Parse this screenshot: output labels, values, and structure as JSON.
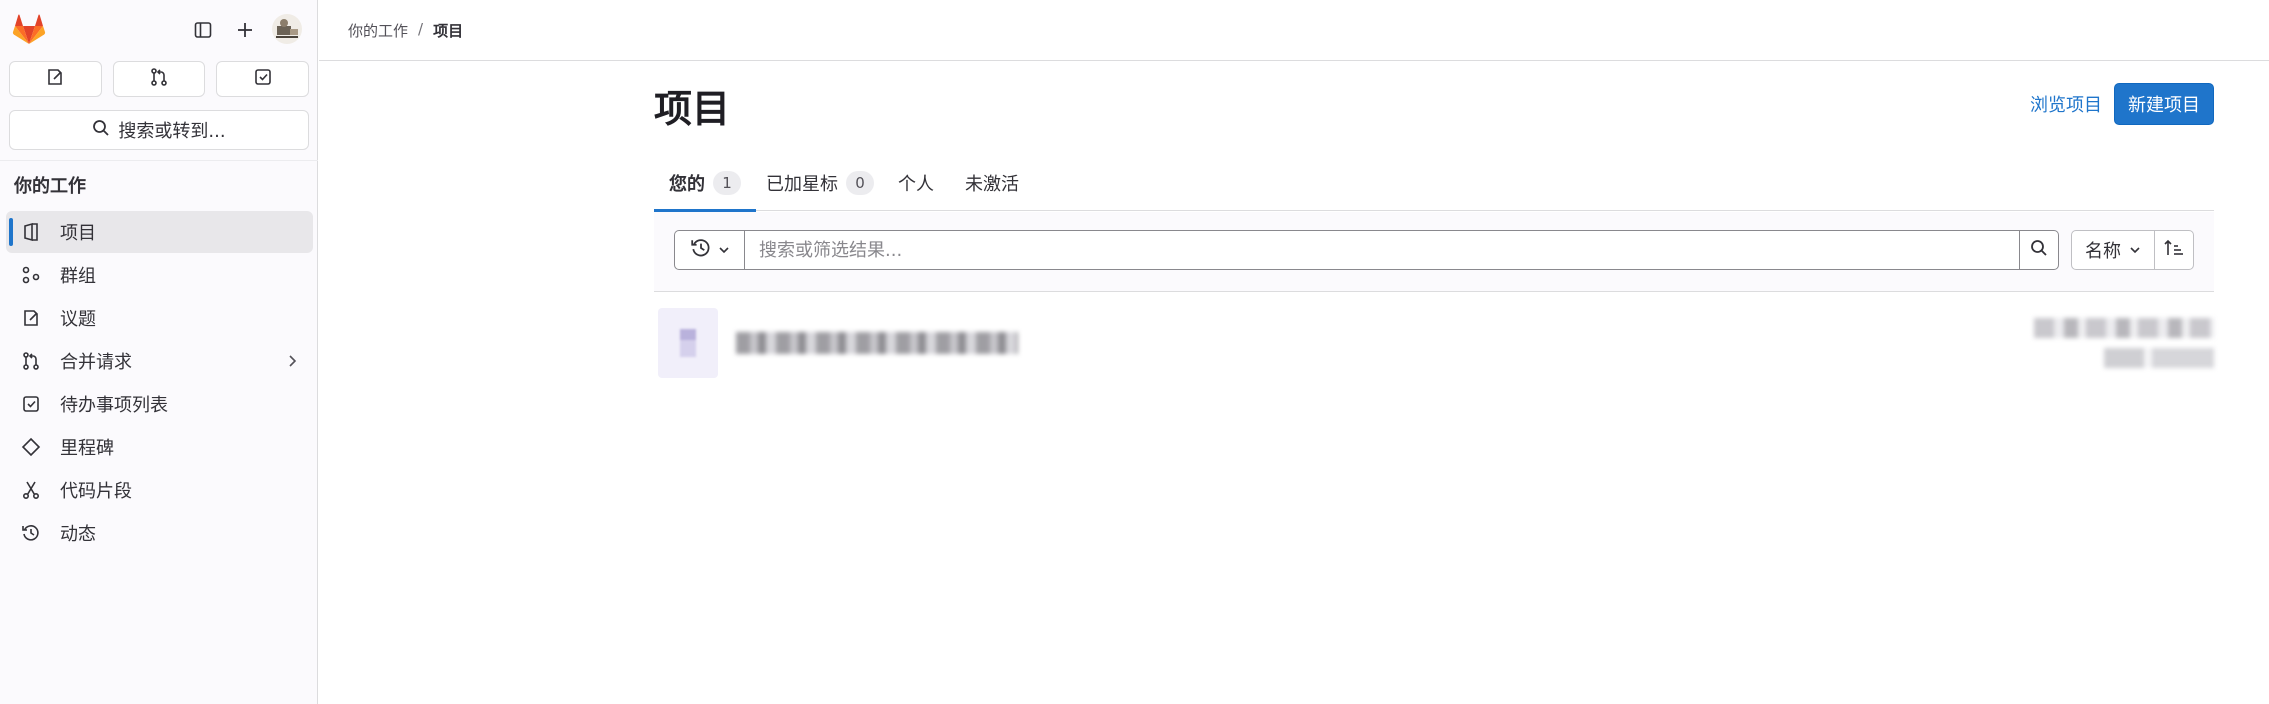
{
  "sidebar": {
    "quick_actions": [
      {
        "name": "issues"
      },
      {
        "name": "merge-requests"
      },
      {
        "name": "todos"
      }
    ],
    "search_label": "搜索或转到...",
    "section_title": "你的工作",
    "items": [
      {
        "label": "项目",
        "icon": "project-icon"
      },
      {
        "label": "群组",
        "icon": "group-icon"
      },
      {
        "label": "议题",
        "icon": "issues-icon"
      },
      {
        "label": "合并请求",
        "icon": "merge-request-icon"
      },
      {
        "label": "待办事项列表",
        "icon": "todo-icon"
      },
      {
        "label": "里程碑",
        "icon": "milestone-icon"
      },
      {
        "label": "代码片段",
        "icon": "snippet-icon"
      },
      {
        "label": "动态",
        "icon": "activity-icon"
      }
    ]
  },
  "breadcrumb": {
    "parent": "你的工作",
    "separator": "/",
    "current": "项目"
  },
  "page": {
    "title": "项目",
    "explore_label": "浏览项目",
    "new_label": "新建项目"
  },
  "tabs": [
    {
      "label": "您的",
      "count": "1"
    },
    {
      "label": "已加星标",
      "count": "0"
    },
    {
      "label": "个人"
    },
    {
      "label": "未激活"
    }
  ],
  "filter": {
    "placeholder": "搜索或筛选结果...",
    "sort_label": "名称"
  },
  "colors": {
    "accent": "#1f75cb",
    "sidebar_bg": "#fbfafd",
    "active_item_bg": "#e8e7ea"
  }
}
